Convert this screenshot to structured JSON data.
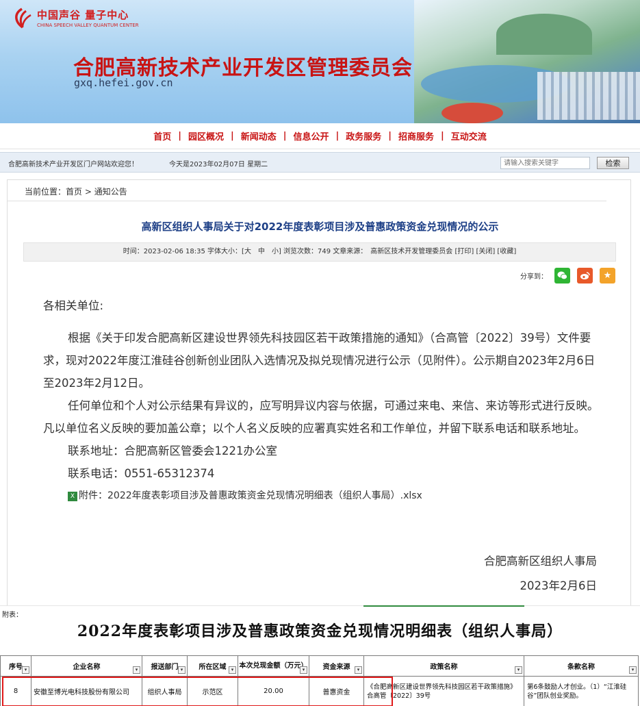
{
  "header": {
    "logo_cn": "中国声谷 量子中心",
    "logo_en": "CHINA SPEECH VALLEY QUANTUM CENTER",
    "site_title": "合肥高新技术产业开发区管理委员会",
    "site_url": "gxq.hefei.gov.cn"
  },
  "nav": {
    "items": [
      "首页",
      "园区概况",
      "新闻动态",
      "信息公开",
      "政务服务",
      "招商服务",
      "互动交流"
    ],
    "separator": "|"
  },
  "statusbar": {
    "welcome": "合肥高新技术产业开发区门户网站欢迎您！",
    "date": "今天是2023年02月07日 星期二",
    "search_placeholder": "请输入搜索关键字",
    "search_button": "检索"
  },
  "breadcrumb": {
    "prefix": "当前位置：",
    "home": "首页",
    "arrow": ">",
    "current": "通知公告"
  },
  "article": {
    "title": "高新区组织人事局关于对2022年度表彰项目涉及普惠政策资金兑现情况的公示",
    "meta": "时间：2023-02-06 18:35 字体大小：[大　中　小] 浏览次数：749 文章来源：　高新区技术开发管理委员会 [打印] [关闭] [收藏]",
    "share_label": "分享到：",
    "greeting": "各相关单位:",
    "para1": "根据《关于印发合肥高新区建设世界领先科技园区若干政策措施的通知》（合高管〔2022〕39号）文件要求，现对2022年度江淮硅谷创新创业团队入选情况及拟兑现情况进行公示（见附件）。公示期自2023年2月6日至2023年2月12日。",
    "para2": "任何单位和个人对公示结果有异议的，应写明异议内容与依据，可通过来电、来信、来访等形式进行反映。凡以单位名义反映的要加盖公章；以个人名义反映的应署真实姓名和工作单位，并留下联系电话和联系地址。",
    "address": "联系地址：合肥高新区管委会1221办公室",
    "phone": "联系电话：0551-65312374",
    "attachment": "附件：2022年度表彰项目涉及普惠政策资金兑现情况明细表（组织人事局）.xlsx",
    "sign_org": "合肥高新区组织人事局",
    "sign_date": "2023年2月6日"
  },
  "sheet": {
    "label": "附表：",
    "title": "2022年度表彰项目涉及普惠政策资金兑现情况明细表（组织人事局）",
    "columns": [
      "序号",
      "企业名称",
      "报送部门",
      "所在区域",
      "本次兑现金额（万元）",
      "资金来源",
      "政策名称",
      "条款名称"
    ],
    "row": {
      "index": "8",
      "company": "安徽至博光电科技股份有限公司",
      "department": "组织人事局",
      "region": "示范区",
      "amount": "20.00",
      "source": "普惠资金",
      "policy": "《合肥高新区建设世界领先科技园区若干政策措施》合高管〔2022〕39号",
      "clause": "第6条鼓励人才创业。（1）“江淮硅谷”团队创业奖励。"
    }
  },
  "colors": {
    "brand_red": "#c81414",
    "title_blue": "#1d3f86",
    "highlight": "#e01818"
  }
}
